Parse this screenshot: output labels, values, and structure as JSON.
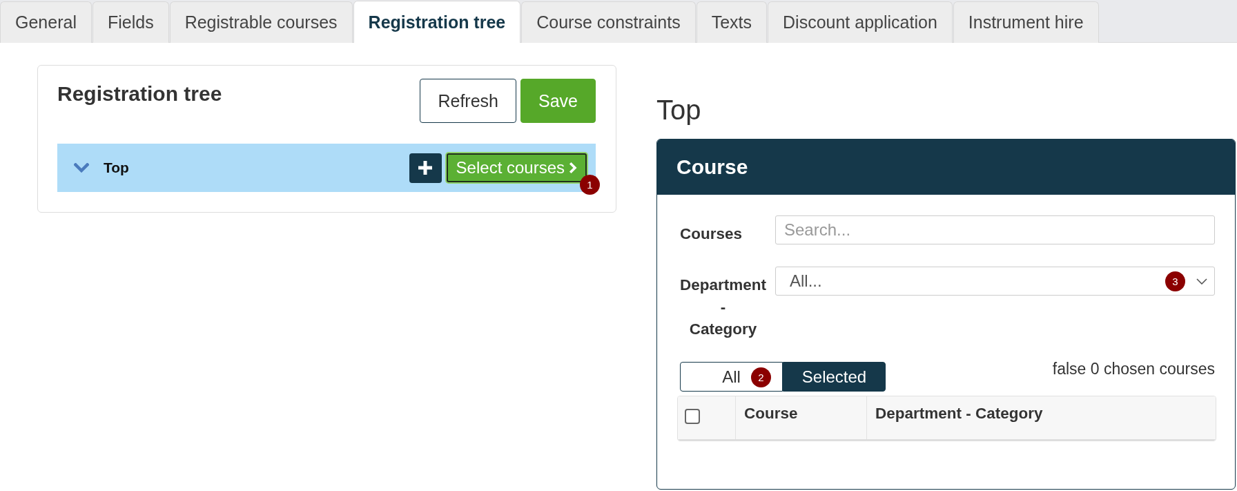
{
  "tabs": [
    {
      "label": "General",
      "selected": false
    },
    {
      "label": "Fields",
      "selected": false
    },
    {
      "label": "Registrable courses",
      "selected": false
    },
    {
      "label": "Registration tree",
      "selected": true
    },
    {
      "label": "Course constraints",
      "selected": false
    },
    {
      "label": "Texts",
      "selected": false
    },
    {
      "label": "Discount application",
      "selected": false
    },
    {
      "label": "Instrument hire",
      "selected": false
    }
  ],
  "tree": {
    "title": "Registration tree",
    "buttons": [
      {
        "label": "Refresh",
        "kind": "outline"
      },
      {
        "label": "Save",
        "kind": "primary"
      }
    ],
    "nodes": [
      {
        "label": "Top",
        "expanded": true,
        "selected": true,
        "select_button": "Select courses",
        "badge": "1"
      }
    ]
  },
  "detail": {
    "heading": "Top",
    "panel": {
      "title": "Course",
      "fields": [
        {
          "kind": "search",
          "label": "Courses",
          "placeholder": "Search..."
        },
        {
          "kind": "select",
          "label": "Department - Category",
          "value": "All...",
          "badge": "3"
        }
      ],
      "filter": [
        {
          "label": "All",
          "selected": false,
          "badge": "2"
        },
        {
          "label": "Selected",
          "selected": true
        }
      ],
      "summary": "false 0 chosen courses",
      "table": {
        "select_all": {
          "checked": false
        },
        "columns": [
          "Course",
          "Department - Category"
        ]
      }
    }
  }
}
